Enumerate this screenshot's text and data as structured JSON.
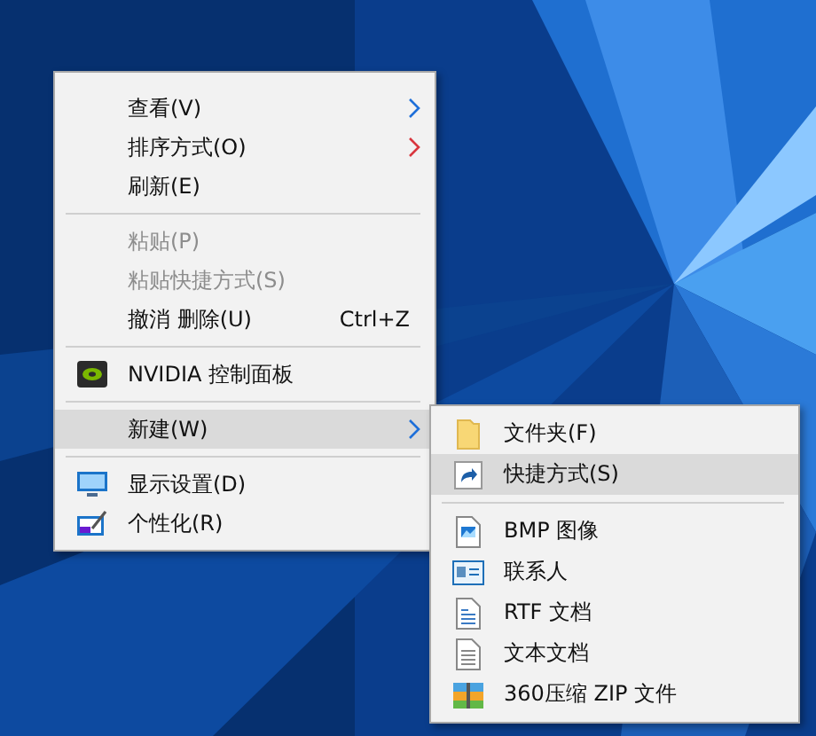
{
  "context_menu": {
    "items": [
      {
        "kind": "item",
        "label": "查看(V)",
        "submenu": true,
        "color": "#1e6fd9",
        "disabled": false,
        "selected": false
      },
      {
        "kind": "item",
        "label": "排序方式(O)",
        "submenu": true,
        "color": "#d9363e",
        "disabled": false,
        "selected": false
      },
      {
        "kind": "item",
        "label": "刷新(E)",
        "submenu": false,
        "disabled": false,
        "selected": false
      },
      {
        "kind": "separator"
      },
      {
        "kind": "item",
        "label": "粘贴(P)",
        "submenu": false,
        "disabled": true,
        "selected": false
      },
      {
        "kind": "item",
        "label": "粘贴快捷方式(S)",
        "submenu": false,
        "disabled": true,
        "selected": false
      },
      {
        "kind": "item",
        "label": "撤消 删除(U)",
        "shortcut": "Ctrl+Z",
        "submenu": false,
        "disabled": false,
        "selected": false
      },
      {
        "kind": "separator"
      },
      {
        "kind": "item",
        "label": "NVIDIA 控制面板",
        "submenu": false,
        "disabled": false,
        "selected": false
      },
      {
        "kind": "separator"
      },
      {
        "kind": "item",
        "label": "新建(W)",
        "submenu": true,
        "color": "#1e6fd9",
        "disabled": false,
        "selected": true
      },
      {
        "kind": "separator"
      },
      {
        "kind": "item",
        "label": "显示设置(D)",
        "submenu": false,
        "disabled": false,
        "selected": false
      },
      {
        "kind": "item",
        "label": "个性化(R)",
        "submenu": false,
        "disabled": false,
        "selected": false
      }
    ]
  },
  "new_submenu": {
    "items": [
      {
        "kind": "item",
        "label": "文件夹(F)",
        "selected": false
      },
      {
        "kind": "item",
        "label": "快捷方式(S)",
        "selected": true
      },
      {
        "kind": "separator"
      },
      {
        "kind": "item",
        "label": "BMP 图像",
        "selected": false
      },
      {
        "kind": "item",
        "label": "联系人",
        "selected": false
      },
      {
        "kind": "item",
        "label": "RTF 文档",
        "selected": false
      },
      {
        "kind": "item",
        "label": "文本文档",
        "selected": false
      },
      {
        "kind": "item",
        "label": "360压缩 ZIP 文件",
        "selected": false
      }
    ]
  }
}
